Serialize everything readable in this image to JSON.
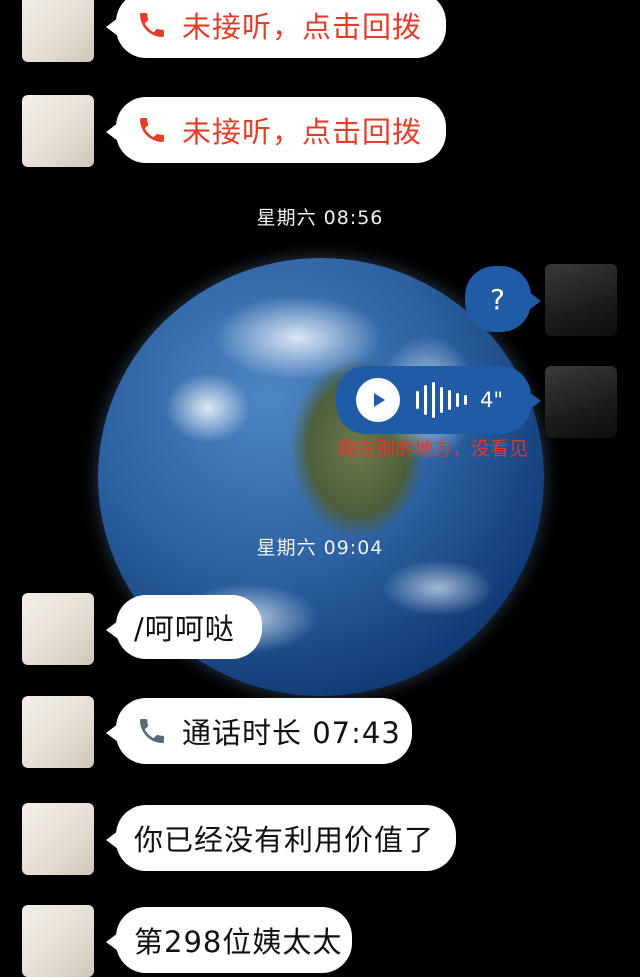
{
  "messages": {
    "missed_call_1": "未接听，点击回拨",
    "missed_call_2": "未接听，点击回拨",
    "time_1": "星期六 08:56",
    "question": "?",
    "voice_duration": "4\"",
    "voice_transcript": "刚在别的地方，没看见",
    "time_2": "星期六 09:04",
    "reply": "/呵呵哒",
    "call_duration": "通话时长 07:43",
    "message_a": "你已经没有利用价值了",
    "message_b": "第298位姨太太"
  },
  "colors": {
    "background": "#000000",
    "incoming_bubble": "#ffffff",
    "outgoing_bubble": "#1f5ca5",
    "missed_call_text": "#e33e2b",
    "transcript_text": "#e0392b"
  },
  "icons": {
    "missed_call": "phone-icon",
    "call_duration": "phone-icon",
    "voice": "play-icon"
  }
}
